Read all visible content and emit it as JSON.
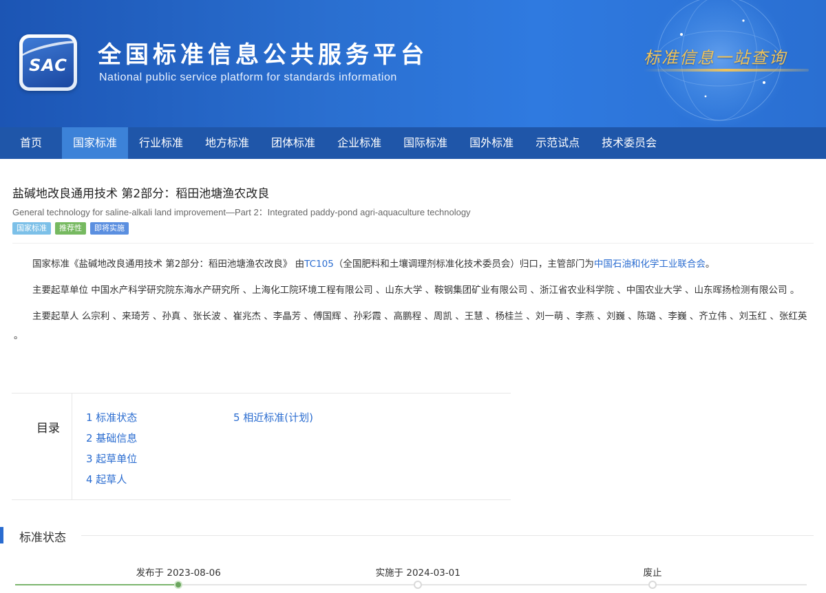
{
  "header": {
    "logo_text": "SAC",
    "title": "全国标准信息公共服务平台",
    "subtitle": "National public service platform  for standards information",
    "slogan": "标准信息一站查询"
  },
  "nav": {
    "items": [
      {
        "label": "首页",
        "active": false
      },
      {
        "label": "国家标准",
        "active": true
      },
      {
        "label": "行业标准",
        "active": false
      },
      {
        "label": "地方标准",
        "active": false
      },
      {
        "label": "团体标准",
        "active": false
      },
      {
        "label": "企业标准",
        "active": false
      },
      {
        "label": "国际标准",
        "active": false
      },
      {
        "label": "国外标准",
        "active": false
      },
      {
        "label": "示范试点",
        "active": false
      },
      {
        "label": "技术委员会",
        "active": false
      }
    ]
  },
  "standard": {
    "title": "盐碱地改良通用技术 第2部分：稻田池塘渔农改良",
    "title_en": "General technology for saline-alkali land improvement—Part 2：Integrated paddy-pond agri-aquaculture technology",
    "badges": [
      {
        "label": "国家标准",
        "color": "#7cc0e8"
      },
      {
        "label": "推荐性",
        "color": "#76b960"
      },
      {
        "label": "即将实施",
        "color": "#5b8fe0"
      }
    ]
  },
  "intro": {
    "prefix": "国家标准《盐碱地改良通用技术 第2部分：稻田池塘渔农改良》 由",
    "tc_link": "TC105",
    "middle": "（全国肥料和土壤调理剂标准化技术委员会）归口，主管部门为",
    "dept_link": "中国石油和化学工业联合会",
    "suffix": "。"
  },
  "drafting_units": {
    "label": "主要起草单位",
    "text": "中国水产科学研究院东海水产研究所 、上海化工院环境工程有限公司 、山东大学 、鞍钢集团矿业有限公司 、浙江省农业科学院 、中国农业大学 、山东晖扬检测有限公司 。"
  },
  "drafters": {
    "label": "主要起草人",
    "text": "么宗利 、来琦芳 、孙真 、张长波 、崔兆杰 、李晶芳 、傅国辉 、孙彩霞 、高鹏程 、周凯 、王慧 、杨桂兰 、刘一萌 、李燕 、刘巍 、陈璐 、李巍 、齐立伟 、刘玉红 、张红英 。"
  },
  "toc": {
    "label": "目录",
    "col1": [
      "1  标准状态",
      "2  基础信息",
      "3  起草单位",
      "4  起草人"
    ],
    "col2": [
      "5  相近标准(计划)"
    ]
  },
  "status_section": {
    "title": "标准状态"
  },
  "timeline": {
    "progress": 0.216,
    "points": [
      {
        "label": "发布于 2023-08-06",
        "pos": 0.216,
        "done": true
      },
      {
        "label": "实施于 2024-03-01",
        "pos": 0.506,
        "done": false
      },
      {
        "label": "废止",
        "pos": 0.79,
        "done": false
      }
    ]
  },
  "colors": {
    "nav_bg": "#1f56a9",
    "nav_active": "#3c82d8",
    "link": "#2a6cd0",
    "timeline_done": "#6aa55d"
  }
}
